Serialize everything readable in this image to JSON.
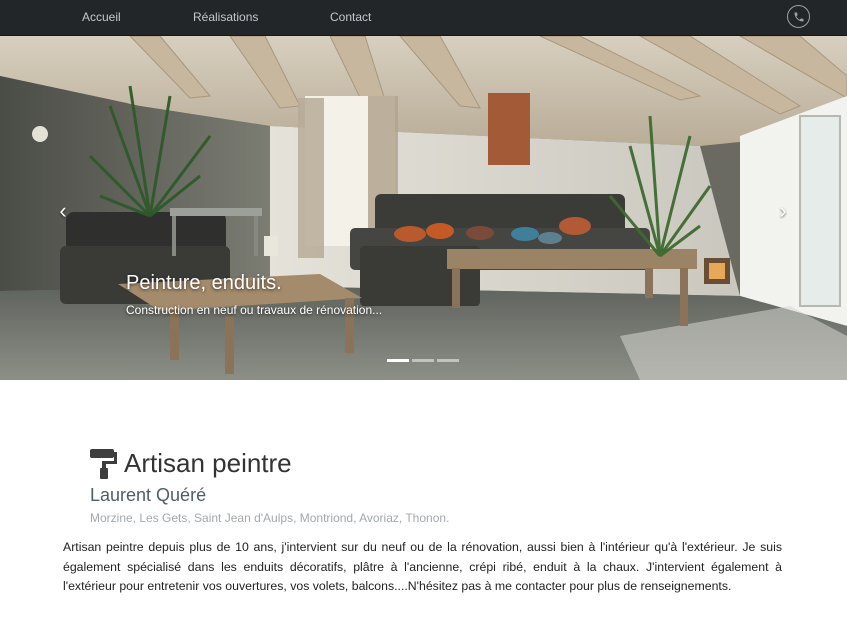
{
  "nav": {
    "items": [
      "Accueil",
      "Réalisations",
      "Contact"
    ],
    "phone_icon": "phone-icon"
  },
  "carousel": {
    "caption_title": "Peinture, enduits.",
    "caption_text": "Construction en neuf ou travaux de rénovation...",
    "slide_count": 3,
    "active_index": 0,
    "prev_icon": "chevron-left-icon",
    "next_icon": "chevron-right-icon"
  },
  "content": {
    "title_icon": "paint-roller-icon",
    "title": "Artisan peintre",
    "subtitle": "Laurent Quéré",
    "locations": "Morzine, Les Gets, Saint Jean d'Aulps, Montriond, Avoriaz, Thonon.",
    "intro": "Artisan peintre depuis plus de 10 ans, j'intervient sur du neuf ou de la rénovation, aussi bien à l'intérieur qu'à l'extérieur. Je suis également spécialisé dans les enduits décoratifs, plâtre à l'ancienne, crépi ribé, enduit à la chaux. J'intervient également à l'extérieur pour entretenir vos ouvertures, vos volets, balcons....N'hésitez pas à me contacter pour plus de renseignements."
  },
  "colors": {
    "navbar_bg": "#222629",
    "nav_text": "#c4c8cc",
    "subtitle": "#4f5d6a",
    "muted": "#a3a8ad"
  }
}
